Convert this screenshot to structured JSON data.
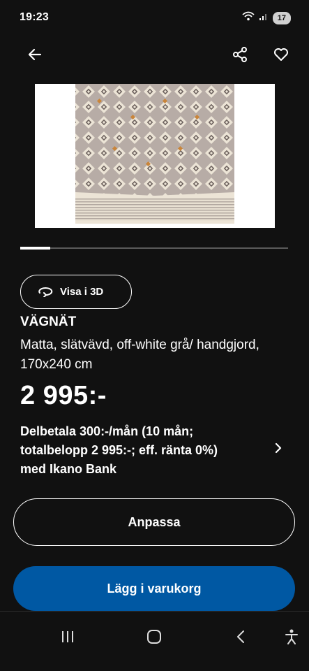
{
  "status_bar": {
    "time": "19:23",
    "battery": "17"
  },
  "product": {
    "name": "VÄGNÄT",
    "description": "Matta, slätvävd, off-white grå/ handgjord, 170x240 cm",
    "price": "2 995:-"
  },
  "view_3d": {
    "label": "Visa i 3D"
  },
  "financing": {
    "text": "Delbetala 300:-/mån (10 mån; totalbelopp 2 995:-; eff. ränta 0%) med Ikano Bank"
  },
  "actions": {
    "customize_label": "Anpassa",
    "add_to_cart_label": "Lägg i varukorg"
  },
  "carousel": {
    "current": 1,
    "total": 9
  },
  "colors": {
    "background": "#111111",
    "primary_button": "#0058a3",
    "text": "#ffffff"
  },
  "icons": [
    "back-arrow-icon",
    "share-icon",
    "heart-icon",
    "rotate-3d-icon",
    "chevron-right-icon",
    "recent-apps-icon",
    "home-icon",
    "back-nav-icon",
    "accessibility-icon",
    "wifi-icon",
    "signal-icon"
  ]
}
